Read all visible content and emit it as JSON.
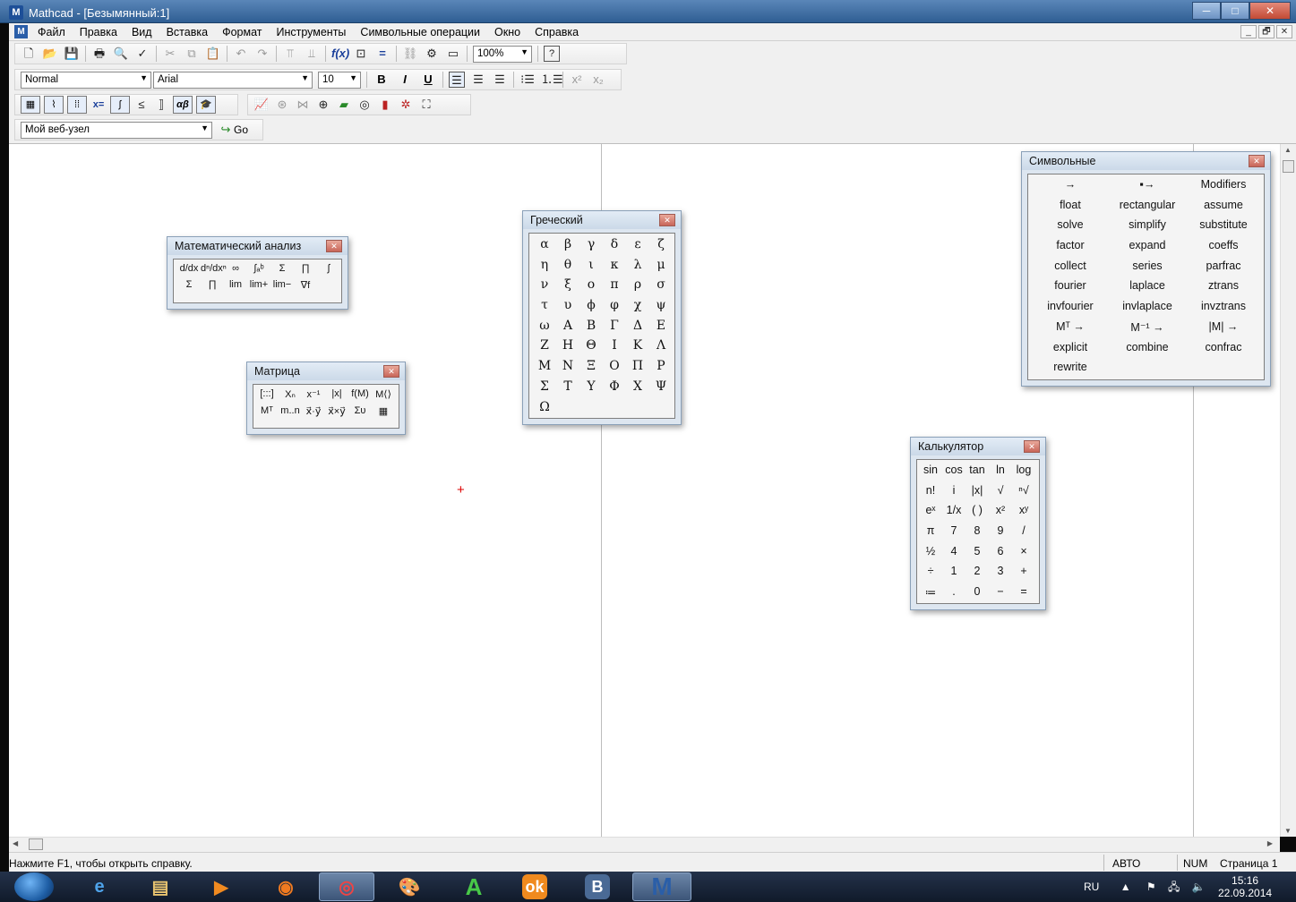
{
  "window": {
    "title": "Mathcad - [Безымянный:1]",
    "min": "─",
    "max": "□",
    "close": "✕"
  },
  "menu": [
    "Файл",
    "Правка",
    "Вид",
    "Вставка",
    "Формат",
    "Инструменты",
    "Символьные операции",
    "Окно",
    "Справка"
  ],
  "mdi": {
    "min": "_",
    "restore": "🗗",
    "close": "✕"
  },
  "toolbar_standard": {
    "zoom": "100%",
    "help": "?"
  },
  "toolbar_format": {
    "style": "Normal",
    "font": "Arial",
    "size": "10",
    "bold": "B",
    "italic": "I",
    "underline": "U"
  },
  "toolbar_math": {
    "boolean": "x=",
    "greek": "αβ"
  },
  "toolbar_web": {
    "url": "Мой веб-узел",
    "go": "Go"
  },
  "palettes": {
    "calculus": {
      "title": "Математический анализ",
      "row1": [
        "d/dx",
        "dⁿ/dxⁿ",
        "∞",
        "∫ₐᵇ",
        "Σ",
        "∏",
        "∫"
      ],
      "row2": [
        "Σ",
        "∏",
        "lim",
        "lim+",
        "lim−",
        "∇f"
      ]
    },
    "matrix": {
      "title": "Матрица",
      "row1": [
        "[:::]",
        "Xₙ",
        "x⁻¹",
        "|x|",
        "f(M)",
        "M⟨⟩"
      ],
      "row2": [
        "Mᵀ",
        "m..n",
        "x⃗·y⃗",
        "x⃗×y⃗",
        "Συ",
        "▦"
      ]
    },
    "greek": {
      "title": "Греческий",
      "letters": [
        "α",
        "β",
        "γ",
        "δ",
        "ε",
        "ζ",
        "η",
        "θ",
        "ι",
        "κ",
        "λ",
        "μ",
        "ν",
        "ξ",
        "ο",
        "π",
        "ρ",
        "σ",
        "τ",
        "υ",
        "ϕ",
        "φ",
        "χ",
        "ψ",
        "ω",
        "Α",
        "Β",
        "Γ",
        "Δ",
        "Ε",
        "Ζ",
        "Η",
        "Θ",
        "Ι",
        "Κ",
        "Λ",
        "Μ",
        "Ν",
        "Ξ",
        "Ο",
        "Π",
        "Ρ",
        "Σ",
        "Τ",
        "Υ",
        "Φ",
        "Χ",
        "Ψ",
        "Ω"
      ]
    },
    "symbolic": {
      "title": "Символьные",
      "items": [
        "→",
        "▪→",
        "Modifiers",
        "float",
        "rectangular",
        "assume",
        "solve",
        "simplify",
        "substitute",
        "factor",
        "expand",
        "coeffs",
        "collect",
        "series",
        "parfrac",
        "fourier",
        "laplace",
        "ztrans",
        "invfourier",
        "invlaplace",
        "invztrans",
        "Mᵀ →",
        "M⁻¹ →",
        "|M| →",
        "explicit",
        "combine",
        "confrac",
        "rewrite",
        "",
        ""
      ]
    },
    "calculator": {
      "title": "Калькулятор",
      "keys": [
        "sin",
        "cos",
        "tan",
        "ln",
        "log",
        "n!",
        "i",
        "|x|",
        "√",
        "ⁿ√",
        "eˣ",
        "1/x",
        "( )",
        "x²",
        "xʸ",
        "π",
        "7",
        "8",
        "9",
        "/",
        "½",
        "4",
        "5",
        "6",
        "×",
        "÷",
        "1",
        "2",
        "3",
        "+",
        "≔",
        ".",
        "0",
        "−",
        "="
      ]
    }
  },
  "status": {
    "help": "Нажмите F1, чтобы открыть справку.",
    "mode": "АВТО",
    "num": "NUM",
    "page": "Страница 1"
  },
  "taskbar": {
    "lang": "RU",
    "time": "15:16",
    "date": "22.09.2014",
    "apps": [
      "IE",
      "Explorer",
      "Media",
      "Firefox",
      "Chrome",
      "Paint",
      "A",
      "OK",
      "B",
      "M"
    ]
  }
}
